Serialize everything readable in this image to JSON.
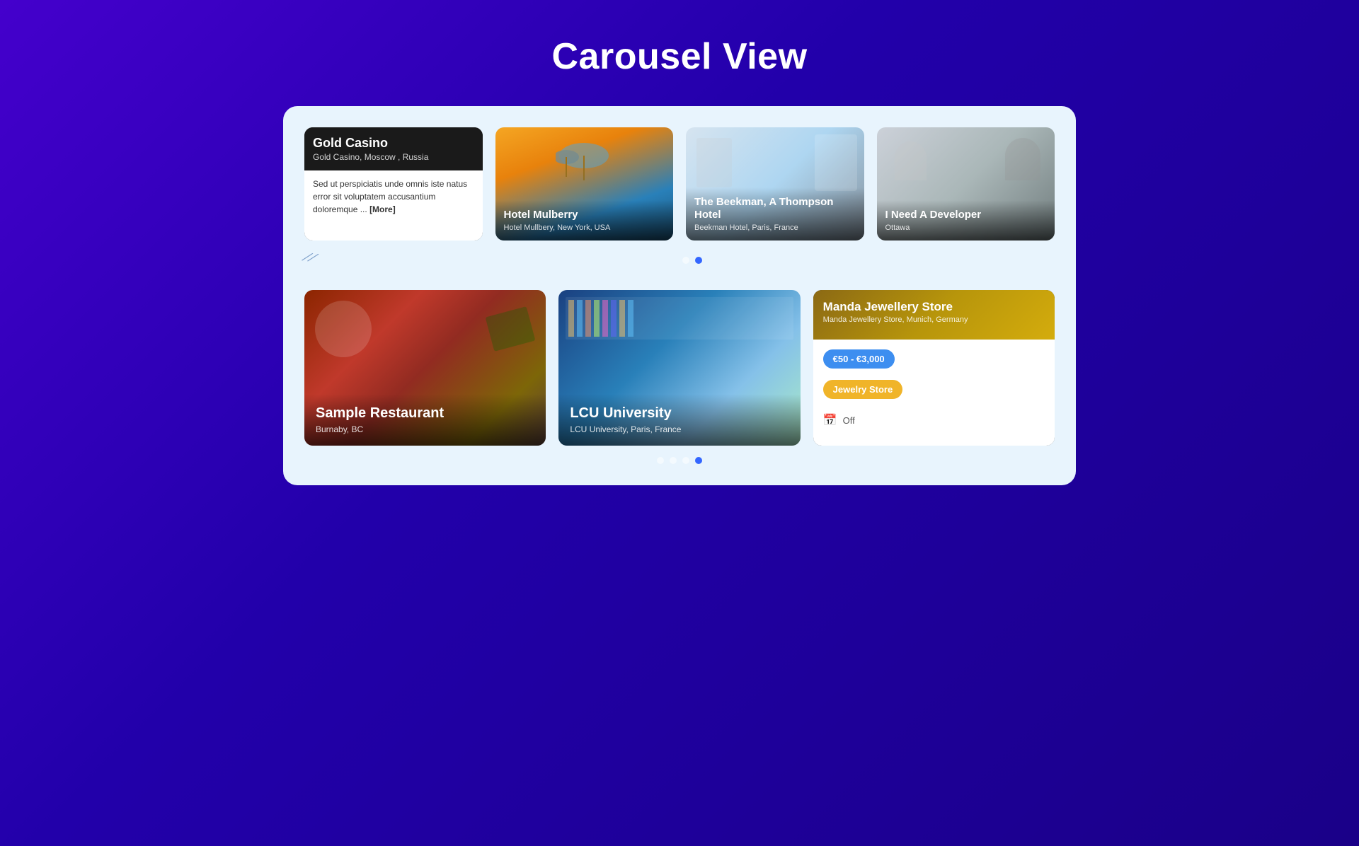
{
  "page": {
    "title": "Carousel View",
    "background_color": "#3300bb"
  },
  "top_carousel": {
    "cards": [
      {
        "id": "gold-casino",
        "name": "Gold Casino",
        "subtitle": "Gold Casino, Moscow , Russia",
        "description": "Sed ut perspiciatis unde omnis iste natus error sit voluptatem accusantium doloremque ...",
        "more_label": "[More]",
        "type": "text-card"
      },
      {
        "id": "hotel-mulberry",
        "name": "Hotel Mulberry",
        "subtitle": "Hotel Mullbery, New York, USA",
        "type": "image-card"
      },
      {
        "id": "beekman-hotel",
        "name": "The Beekman, A Thompson Hotel",
        "subtitle": "Beekman Hotel, Paris, France",
        "type": "image-card"
      },
      {
        "id": "i-need-developer",
        "name": "I Need A Developer",
        "subtitle": "Ottawa",
        "type": "image-card"
      }
    ],
    "dots": [
      {
        "active": false
      },
      {
        "active": true
      }
    ]
  },
  "bottom_carousel": {
    "cards": [
      {
        "id": "sample-restaurant",
        "name": "Sample Restaurant",
        "subtitle": "Burnaby, BC",
        "type": "image-card"
      },
      {
        "id": "lcu-university",
        "name": "LCU University",
        "subtitle": "LCU University, Paris, France",
        "type": "image-card"
      },
      {
        "id": "manda-jewellery",
        "name": "Manda Jewellery Store",
        "subtitle": "Manda Jewellery Store, Munich, Germany",
        "price_range": "€50 - €3,000",
        "category": "Jewelry Store",
        "status_label": "Off",
        "type": "info-card"
      }
    ],
    "dots": [
      {
        "active": false
      },
      {
        "active": false
      },
      {
        "active": false
      },
      {
        "active": true
      }
    ]
  },
  "decorative": {
    "arrow_symbol": "≪"
  }
}
